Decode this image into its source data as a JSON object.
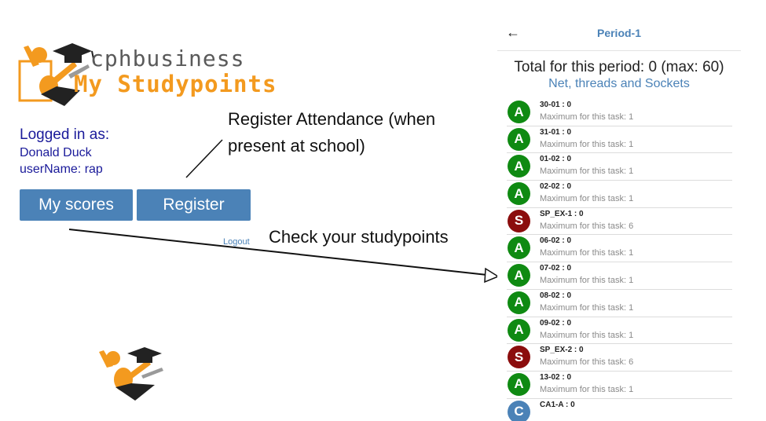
{
  "logo": {
    "word1": "cphbusiness",
    "word2": "My Studypoints"
  },
  "login": {
    "title": "Logged in as:",
    "name": "Donald Duck",
    "username": "userName:  rap"
  },
  "buttons": {
    "scores": "My scores",
    "register": "Register",
    "logout": "Logout"
  },
  "notes": {
    "register_line1": "Register Attendance (when",
    "register_line2": "present at school)",
    "check": "Check your studypoints"
  },
  "phone": {
    "back_icon": "arrow-left-icon",
    "title": "Period-1",
    "total": "Total for this period: 0 (max: 60)",
    "subtitle": "Net, threads and Sockets",
    "tasks": [
      {
        "badge": "A",
        "color": "#0f8a12",
        "name": "30-01 : 0",
        "max": "Maximum for this task: 1"
      },
      {
        "badge": "A",
        "color": "#0f8a12",
        "name": "31-01 : 0",
        "max": "Maximum for this task: 1"
      },
      {
        "badge": "A",
        "color": "#0f8a12",
        "name": "01-02 : 0",
        "max": "Maximum for this task: 1"
      },
      {
        "badge": "A",
        "color": "#0f8a12",
        "name": "02-02 : 0",
        "max": "Maximum for this task: 1"
      },
      {
        "badge": "S",
        "color": "#8b0d0d",
        "name": "SP_EX-1 : 0",
        "max": "Maximum for this task: 6"
      },
      {
        "badge": "A",
        "color": "#0f8a12",
        "name": "06-02 : 0",
        "max": "Maximum for this task: 1"
      },
      {
        "badge": "A",
        "color": "#0f8a12",
        "name": "07-02 : 0",
        "max": "Maximum for this task: 1"
      },
      {
        "badge": "A",
        "color": "#0f8a12",
        "name": "08-02 : 0",
        "max": "Maximum for this task: 1"
      },
      {
        "badge": "A",
        "color": "#0f8a12",
        "name": "09-02 : 0",
        "max": "Maximum for this task: 1"
      },
      {
        "badge": "S",
        "color": "#8b0d0d",
        "name": "SP_EX-2 : 0",
        "max": "Maximum for this task: 6"
      },
      {
        "badge": "A",
        "color": "#0f8a12",
        "name": "13-02 : 0",
        "max": "Maximum for this task: 1"
      },
      {
        "badge": "C",
        "color": "#4b82b7",
        "name": "CA1-A : 0",
        "max": ""
      }
    ]
  },
  "colors": {
    "primary": "#4b82b7",
    "logo_orange": "#f39a1f",
    "login_text": "#1a1a9a",
    "attendance_green": "#0f8a12",
    "studypoint_red": "#8b0d0d"
  }
}
